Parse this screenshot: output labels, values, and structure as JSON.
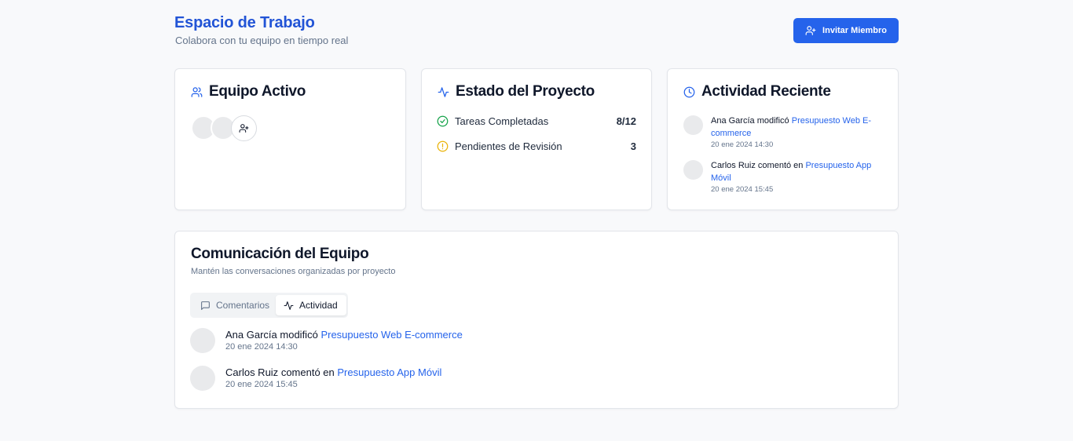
{
  "header": {
    "title": "Espacio de Trabajo",
    "subtitle": "Colabora con tu equipo en tiempo real",
    "invite_label": "Invitar Miembro"
  },
  "team_card": {
    "title": "Equipo Activo"
  },
  "project_card": {
    "title": "Estado del Proyecto",
    "stats": [
      {
        "label": "Tareas Completadas",
        "value": "8/12",
        "color": "#16a34a"
      },
      {
        "label": "Pendientes de Revisión",
        "value": "3",
        "color": "#eab308"
      }
    ]
  },
  "activity_card": {
    "title": "Actividad Reciente",
    "items": [
      {
        "user": "Ana García",
        "action": "modificó",
        "target": "Presupuesto Web E-commerce",
        "time": "20 ene 2024 14:30"
      },
      {
        "user": "Carlos Ruiz",
        "action": "comentó en",
        "target": "Presupuesto App Móvil",
        "time": "20 ene 2024 15:45"
      }
    ]
  },
  "communication": {
    "title": "Comunicación del Equipo",
    "subtitle": "Mantén las conversaciones organizadas por proyecto",
    "tabs": [
      {
        "label": "Comentarios",
        "active": false
      },
      {
        "label": "Actividad",
        "active": true
      }
    ],
    "items": [
      {
        "user": "Ana García",
        "action": "modificó",
        "target": "Presupuesto Web E-commerce",
        "time": "20 ene 2024 14:30"
      },
      {
        "user": "Carlos Ruiz",
        "action": "comentó en",
        "target": "Presupuesto App Móvil",
        "time": "20 ene 2024 15:45"
      }
    ]
  },
  "colors": {
    "accent": "#2563eb",
    "title": "#2254d6",
    "success": "#16a34a",
    "warning": "#eab308"
  }
}
